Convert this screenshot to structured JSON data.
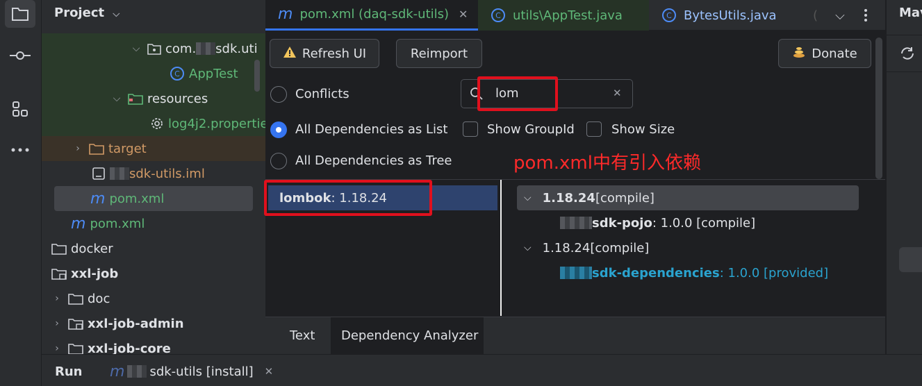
{
  "project_panel": {
    "title": "Project",
    "tree": {
      "package_prefix": "com.",
      "package_suffix": "sdk.uti",
      "apptest": "AppTest",
      "resources": "resources",
      "log4j2": "log4j2.propertie",
      "target": "target",
      "iml": "sdk-utils.iml",
      "pom_selected": "pom.xml",
      "pom": "pom.xml",
      "docker": "docker",
      "xxl_job": "xxl-job",
      "doc": "doc",
      "xxl_job_admin": "xxl-job-admin",
      "xxl_job_core": "xxl-job-core"
    }
  },
  "editor_tabs": [
    {
      "label": "pom.xml (daq-sdk-utils)"
    },
    {
      "label": "utils\\AppTest.java"
    },
    {
      "label": "BytesUtils.java"
    }
  ],
  "maven_side": {
    "title": "Mav"
  },
  "helper": {
    "buttons": {
      "refresh": "Refresh UI",
      "reimport": "Reimport",
      "donate": "Donate"
    },
    "options": {
      "conflicts": "Conflicts",
      "as_list": "All Dependencies as List",
      "as_tree": "All Dependencies as Tree",
      "show_group_id": "Show GroupId",
      "show_size": "Show Size"
    },
    "search": {
      "value": "lom"
    },
    "annotation": "pom.xml中有引入依赖",
    "list": [
      {
        "name": "lombok",
        "version": " : 1.18.24"
      }
    ],
    "tree": [
      {
        "version": "1.18.24",
        "scope": " [compile]"
      },
      {
        "artifact": "sdk-pojo",
        "detail": " : 1.0.0 [compile]"
      },
      {
        "version": "1.18.24",
        "scope": " [compile]"
      },
      {
        "artifact": "sdk-dependencies",
        "detail": " : 1.0.0 [provided]"
      }
    ],
    "bottom_tabs": [
      "Text",
      "Dependency Analyzer"
    ]
  },
  "bottom_bar": {
    "run": "Run",
    "config": "sdk-utils [install]"
  },
  "colors": {
    "accent": "#3574f0",
    "highlight": "#e0101d",
    "green_file": "#5fb878",
    "orange_excluded": "#d19a66",
    "provided_link": "#2aa3cf"
  }
}
